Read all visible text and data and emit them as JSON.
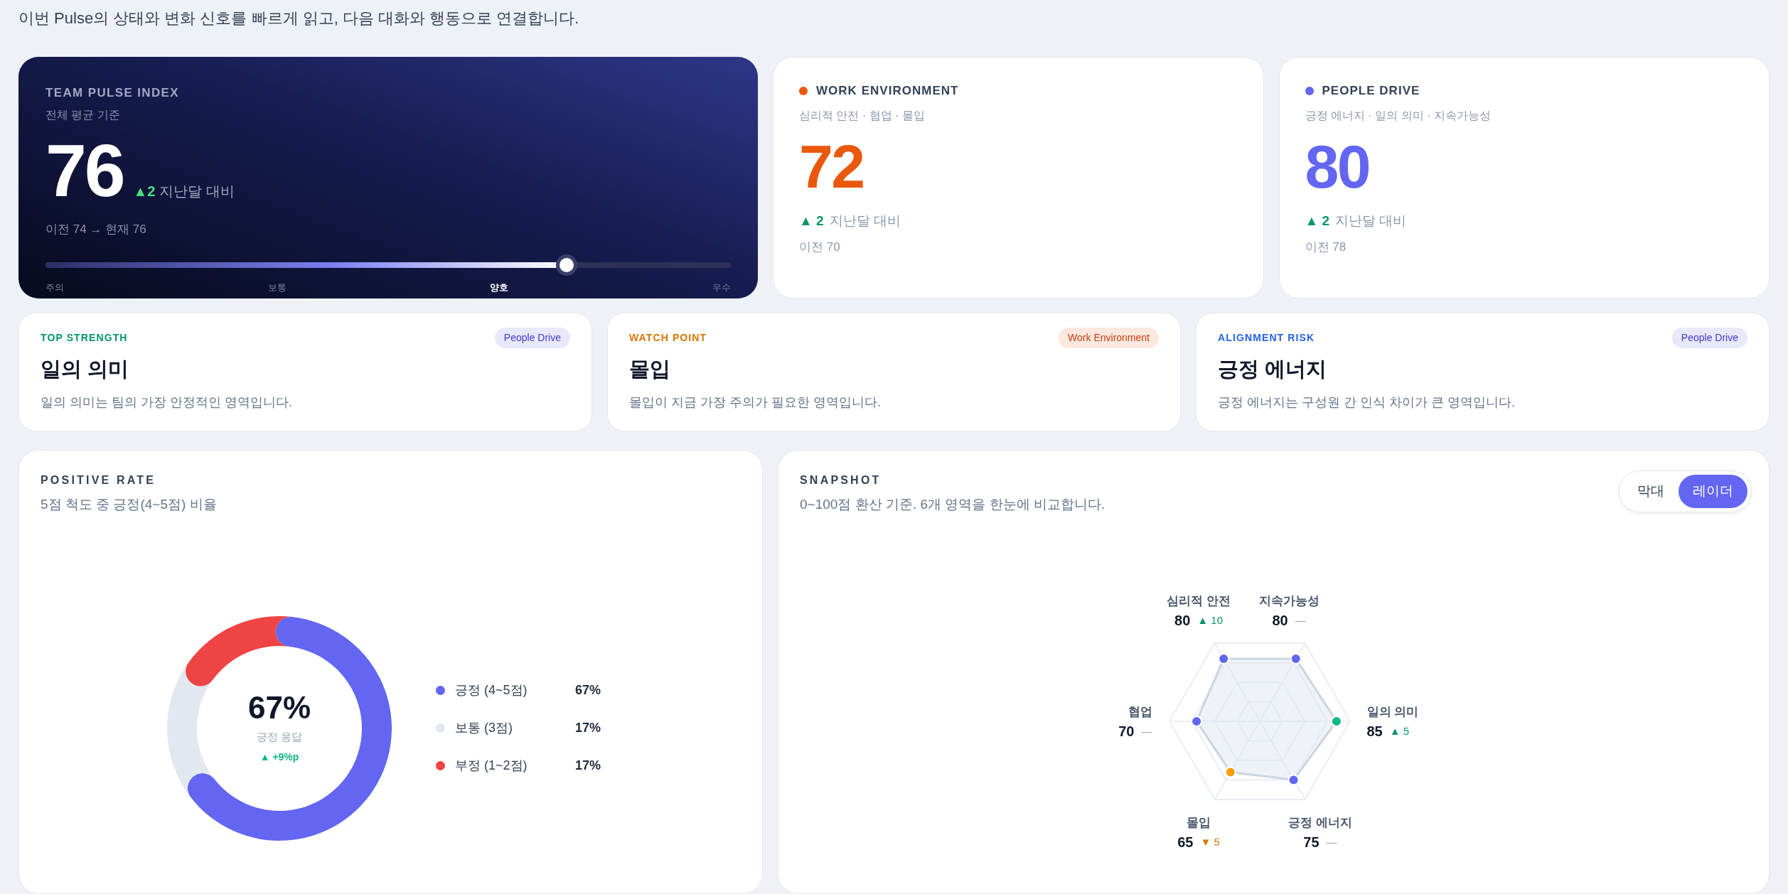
{
  "intro": "이번 Pulse의 상태와 변화 신호를 빠르게 읽고, 다음 대화와 행동으로 연결합니다.",
  "pulse_index": {
    "title": "TEAM PULSE INDEX",
    "subtitle": "전체 평균 기준",
    "value": "76",
    "delta": "▲2",
    "delta_label": "지난달 대비",
    "history": "이전 74 → 현재 76",
    "level": 0.76,
    "bands": [
      {
        "label": "주의",
        "selected": false
      },
      {
        "label": "보통",
        "selected": false
      },
      {
        "label": "양호",
        "selected": true
      },
      {
        "label": "우수",
        "selected": false
      }
    ]
  },
  "metrics": [
    {
      "title": "WORK ENVIRONMENT",
      "color": "#ea580c",
      "subtitle": "심리적 안전 · 협업 · 몰입",
      "value": "72",
      "delta": "▲ 2",
      "delta_label": "지난달 대비",
      "previous": "이전 70"
    },
    {
      "title": "PEOPLE DRIVE",
      "color": "#6366f1",
      "subtitle": "긍정 에너지 · 일의 의미 · 지속가능성",
      "value": "80",
      "delta": "▲ 2",
      "delta_label": "지난달 대비",
      "previous": "이전 78"
    }
  ],
  "insights": [
    {
      "label": "TOP STRENGTH",
      "color": "#059669",
      "tag": "People Drive",
      "kind": "people",
      "title": "일의 의미",
      "description": "일의 의미는 팀의 가장 안정적인 영역입니다."
    },
    {
      "label": "WATCH POINT",
      "color": "#d97706",
      "tag": "Work Environment",
      "kind": "work",
      "title": "몰입",
      "description": "몰입이 지금 가장 주의가 필요한 영역입니다."
    },
    {
      "label": "ALIGNMENT RISK",
      "color": "#2563eb",
      "tag": "People Drive",
      "kind": "people",
      "title": "긍정 에너지",
      "description": "긍정 에너지는 구성원 간 인식 차이가 큰 영역입니다."
    }
  ],
  "positive_rate": {
    "title": "POSITIVE RATE",
    "subtitle": "5점 척도 중 긍정(4~5점) 비율",
    "center_value": "67%",
    "center_label": "긍정 응답",
    "center_delta": "▲ +9%p",
    "chart_data": {
      "type": "donut",
      "categories": [
        "긍정 (4~5점)",
        "보통 (3점)",
        "부정 (1~2점)"
      ],
      "values": [
        67,
        17,
        17
      ]
    },
    "legend": [
      {
        "color": "#6366f1",
        "value": "67%",
        "kind": "convex"
      },
      {
        "color": "#e2e8f0",
        "value": "17%",
        "kind": "concave"
      },
      {
        "color": "#ef4444",
        "value": "17%",
        "kind": "mixed"
      }
    ]
  },
  "snapshot": {
    "title": "SNAPSHOT",
    "subtitle": "0~100점 환산 기준. 6개 영역을 한눈에 비교합니다.",
    "view_toggle": [
      {
        "label": "막대",
        "selected": false
      },
      {
        "label": "레이더",
        "selected": true
      }
    ],
    "axes": [
      {
        "label": "심리적 안전",
        "value": "80",
        "delta": "▲ 10",
        "kind": "up",
        "color": "#6366f1"
      },
      {
        "label": "지속가능성",
        "value": "80",
        "delta": "—",
        "kind": "flat",
        "color": "#6366f1"
      },
      {
        "label": "협업",
        "value": "70",
        "delta": "—",
        "kind": "flat",
        "color": "#6366f1"
      },
      {
        "label": "일의 의미",
        "value": "85",
        "delta": "▲ 5",
        "kind": "up",
        "color": "#10b981"
      },
      {
        "label": "몰입",
        "value": "65",
        "delta": "▼ 5",
        "kind": "down",
        "color": "#f59e0b"
      },
      {
        "label": "긍정 에너지",
        "value": "75",
        "delta": "—",
        "kind": "flat",
        "color": "#6366f1"
      }
    ]
  }
}
